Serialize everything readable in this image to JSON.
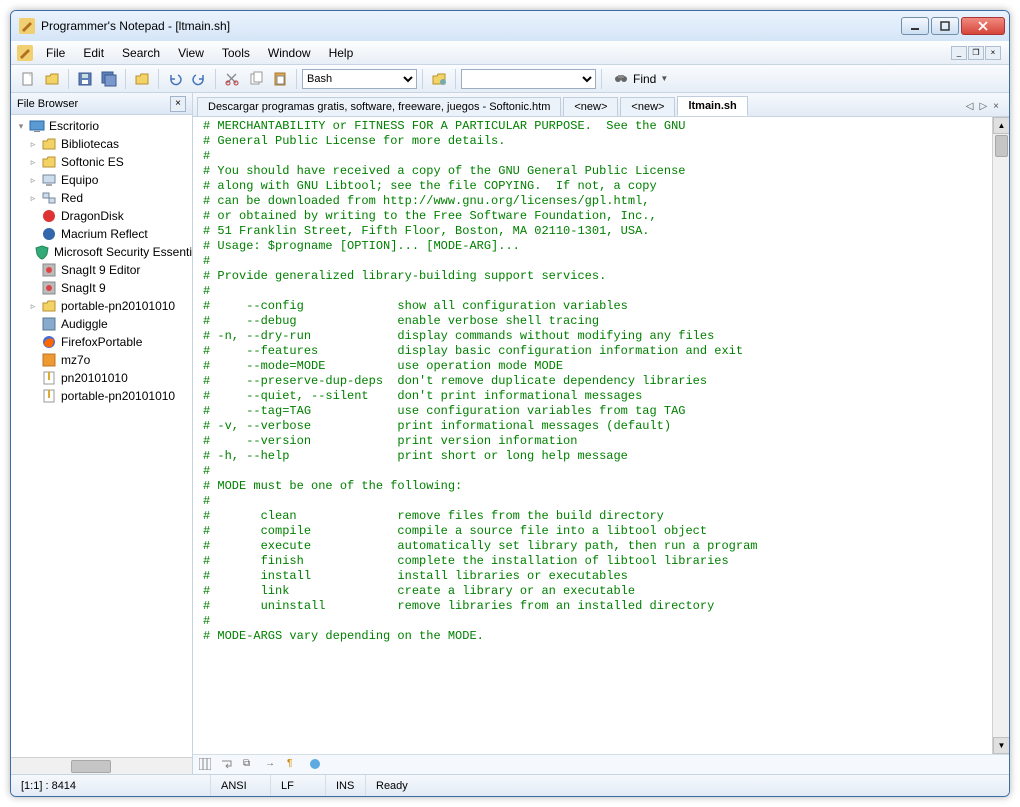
{
  "title": "Programmer's Notepad - [ltmain.sh]",
  "menu": {
    "file": "File",
    "edit": "Edit",
    "search": "Search",
    "view": "View",
    "tools": "Tools",
    "window": "Window",
    "help": "Help"
  },
  "toolbar": {
    "lang": "Bash",
    "find_label": "Find"
  },
  "sidebar": {
    "title": "File Browser",
    "root": "Escritorio",
    "items": [
      {
        "label": "Bibliotecas",
        "icon": "folder",
        "arrow": true
      },
      {
        "label": "Softonic ES",
        "icon": "folder",
        "arrow": true
      },
      {
        "label": "Equipo",
        "icon": "computer",
        "arrow": true
      },
      {
        "label": "Red",
        "icon": "network",
        "arrow": true
      },
      {
        "label": "DragonDisk",
        "icon": "app-red"
      },
      {
        "label": "Macrium Reflect",
        "icon": "app-blue"
      },
      {
        "label": "Microsoft Security Essenti",
        "icon": "shield"
      },
      {
        "label": "SnagIt 9 Editor",
        "icon": "snag"
      },
      {
        "label": "SnagIt 9",
        "icon": "snag"
      },
      {
        "label": "portable-pn20101010",
        "icon": "folder",
        "arrow": true
      },
      {
        "label": "Audiggle",
        "icon": "app"
      },
      {
        "label": "FirefoxPortable",
        "icon": "firefox"
      },
      {
        "label": "mz7o",
        "icon": "app-or"
      },
      {
        "label": "pn20101010",
        "icon": "zip"
      },
      {
        "label": "portable-pn20101010",
        "icon": "zip"
      }
    ]
  },
  "tabs": [
    {
      "label": "Descargar programas gratis, software, freeware, juegos - Softonic.htm",
      "active": false
    },
    {
      "label": "<new>",
      "active": false
    },
    {
      "label": "<new>",
      "active": false
    },
    {
      "label": "ltmain.sh",
      "active": true
    }
  ],
  "code": [
    "# MERCHANTABILITY or FITNESS FOR A PARTICULAR PURPOSE.  See the GNU",
    "# General Public License for more details.",
    "#",
    "# You should have received a copy of the GNU General Public License",
    "# along with GNU Libtool; see the file COPYING.  If not, a copy",
    "# can be downloaded from http://www.gnu.org/licenses/gpl.html,",
    "# or obtained by writing to the Free Software Foundation, Inc.,",
    "# 51 Franklin Street, Fifth Floor, Boston, MA 02110-1301, USA.",
    "",
    "# Usage: $progname [OPTION]... [MODE-ARG]...",
    "#",
    "# Provide generalized library-building support services.",
    "#",
    "#     --config             show all configuration variables",
    "#     --debug              enable verbose shell tracing",
    "# -n, --dry-run            display commands without modifying any files",
    "#     --features           display basic configuration information and exit",
    "#     --mode=MODE          use operation mode MODE",
    "#     --preserve-dup-deps  don't remove duplicate dependency libraries",
    "#     --quiet, --silent    don't print informational messages",
    "#     --tag=TAG            use configuration variables from tag TAG",
    "# -v, --verbose            print informational messages (default)",
    "#     --version            print version information",
    "# -h, --help               print short or long help message",
    "#",
    "# MODE must be one of the following:",
    "#",
    "#       clean              remove files from the build directory",
    "#       compile            compile a source file into a libtool object",
    "#       execute            automatically set library path, then run a program",
    "#       finish             complete the installation of libtool libraries",
    "#       install            install libraries or executables",
    "#       link               create a library or an executable",
    "#       uninstall          remove libraries from an installed directory",
    "#",
    "# MODE-ARGS vary depending on the MODE."
  ],
  "status": {
    "pos": "[1:1] : 8414",
    "enc": "ANSI",
    "eol": "LF",
    "ins": "INS",
    "msg": "Ready"
  }
}
